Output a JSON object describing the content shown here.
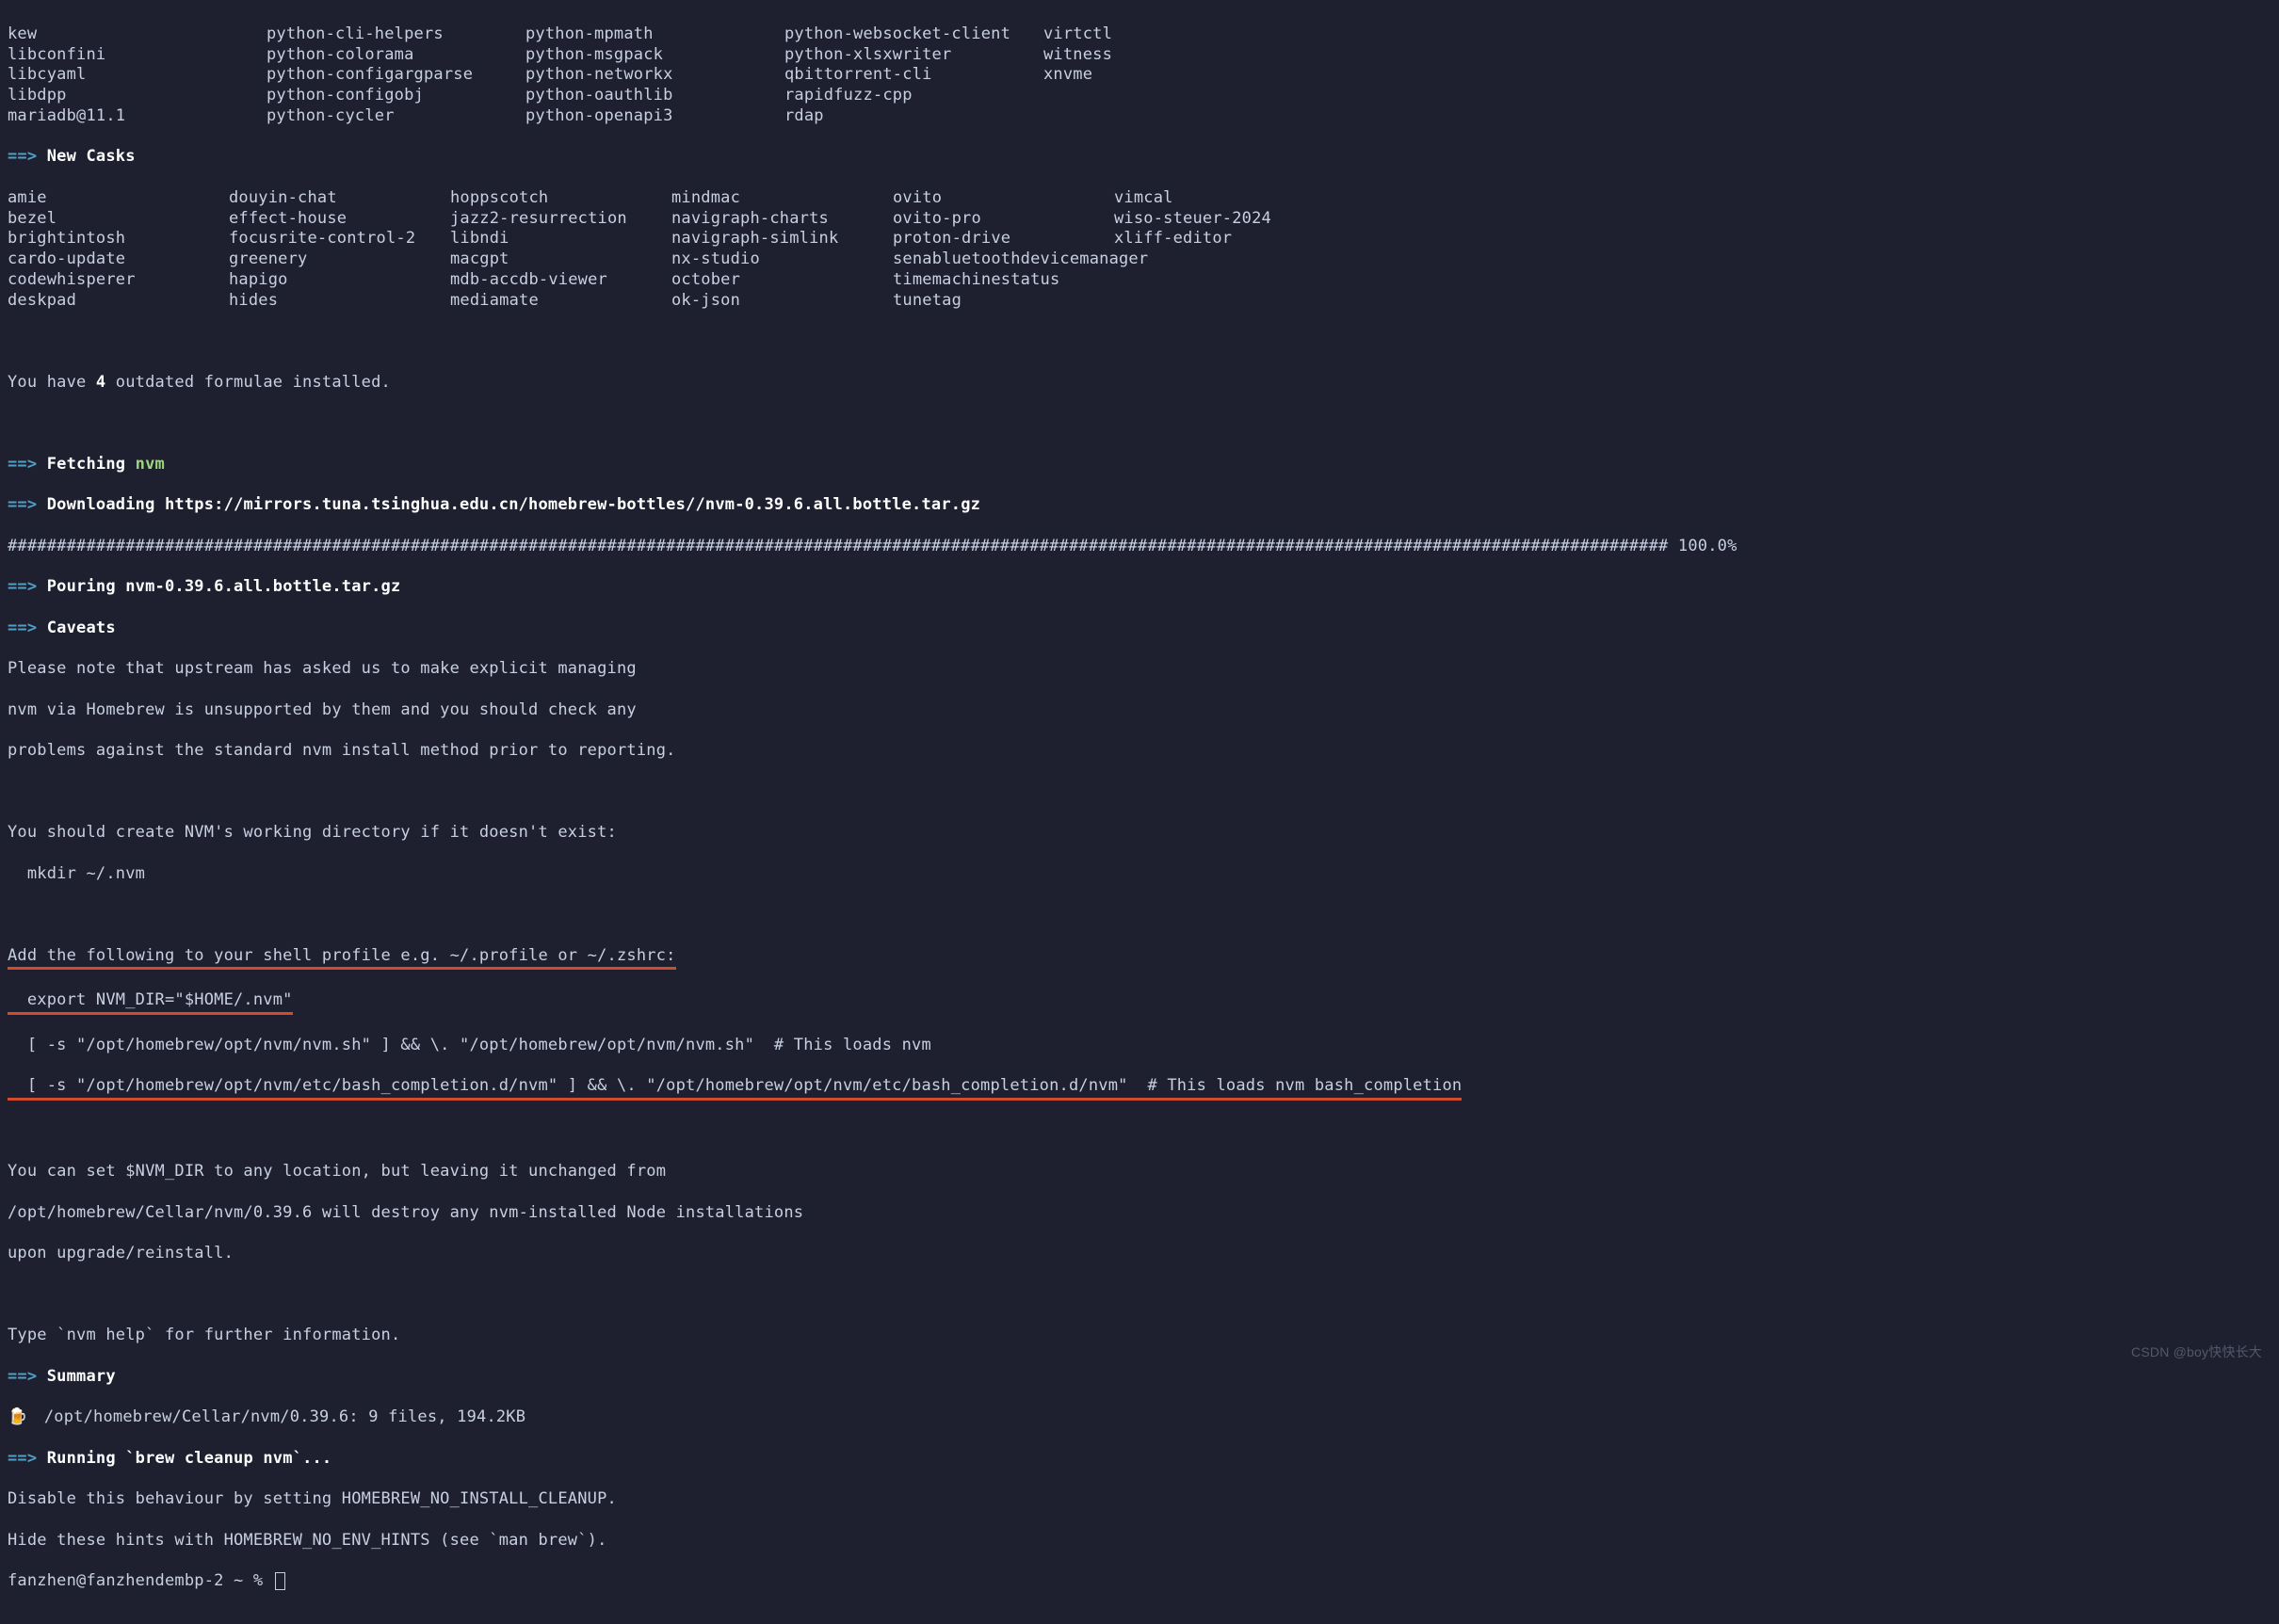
{
  "formulae_remaining": [
    [
      "kew",
      "python-cli-helpers",
      "python-mpmath",
      "python-websocket-client",
      "virtctl"
    ],
    [
      "libconfini",
      "python-colorama",
      "python-msgpack",
      "python-xlsxwriter",
      "witness"
    ],
    [
      "libcyaml",
      "python-configargparse",
      "python-networkx",
      "qbittorrent-cli",
      "xnvme"
    ],
    [
      "libdpp",
      "python-configobj",
      "python-oauthlib",
      "rapidfuzz-cpp",
      ""
    ],
    [
      "mariadb@11.1",
      "python-cycler",
      "python-openapi3",
      "rdap",
      ""
    ]
  ],
  "casks_heading": "New Casks",
  "casks": [
    [
      "amie",
      "douyin-chat",
      "hoppscotch",
      "mindmac",
      "ovito",
      "vimcal"
    ],
    [
      "bezel",
      "effect-house",
      "jazz2-resurrection",
      "navigraph-charts",
      "ovito-pro",
      "wiso-steuer-2024"
    ],
    [
      "brightintosh",
      "focusrite-control-2",
      "libndi",
      "navigraph-simlink",
      "proton-drive",
      "xliff-editor"
    ],
    [
      "cardo-update",
      "greenery",
      "macgpt",
      "nx-studio",
      "senabluetoothdevicemanager",
      ""
    ],
    [
      "codewhisperer",
      "hapigo",
      "mdb-accdb-viewer",
      "october",
      "timemachinestatus",
      ""
    ],
    [
      "deskpad",
      "hides",
      "mediamate",
      "ok-json",
      "tunetag",
      ""
    ]
  ],
  "outdated_line_a": "You have ",
  "outdated_count": "4",
  "outdated_line_b": " outdated formulae installed.",
  "fetching_label": "Fetching ",
  "fetching_pkg": "nvm",
  "downloading_label": "Downloading ",
  "download_url": "https://mirrors.tuna.tsinghua.edu.cn/homebrew-bottles//nvm-0.39.6.all.bottle.tar.gz",
  "progress_bar": "######################################################################################################################################################################### 100.0%",
  "pouring_label": "Pouring ",
  "pouring_file": "nvm-0.39.6.all.bottle.tar.gz",
  "caveats_label": "Caveats",
  "caveats_body_1": "Please note that upstream has asked us to make explicit managing",
  "caveats_body_2": "nvm via Homebrew is unsupported by them and you should check any",
  "caveats_body_3": "problems against the standard nvm install method prior to reporting.",
  "caveats_body_4": "You should create NVM's working directory if it doesn't exist:",
  "caveats_body_5": "  mkdir ~/.nvm",
  "caveats_body_6": "Add the following to your shell profile e.g. ~/.profile or ~/.zshrc:",
  "export_line": "  export NVM_DIR=\"$HOME/.nvm\"",
  "load_nvm_line": "  [ -s \"/opt/homebrew/opt/nvm/nvm.sh\" ] && \\. \"/opt/homebrew/opt/nvm/nvm.sh\"  # This loads nvm",
  "load_bash_line": "  [ -s \"/opt/homebrew/opt/nvm/etc/bash_completion.d/nvm\" ] && \\. \"/opt/homebrew/opt/nvm/etc/bash_completion.d/nvm\"  # This loads nvm bash_completion",
  "caveats_body_7": "You can set $NVM_DIR to any location, but leaving it unchanged from",
  "caveats_body_8": "/opt/homebrew/Cellar/nvm/0.39.6 will destroy any nvm-installed Node installations",
  "caveats_body_9": "upon upgrade/reinstall.",
  "caveats_body_10": "Type `nvm help` for further information.",
  "summary_label": "Summary",
  "beer_icon": "🍺",
  "summary_line": "  /opt/homebrew/Cellar/nvm/0.39.6: 9 files, 194.2KB",
  "running_label": "Running ",
  "running_cmd": "`brew cleanup nvm`",
  "running_suffix": "...",
  "cleanup_1": "Disable this behaviour by setting HOMEBREW_NO_INSTALL_CLEANUP.",
  "cleanup_2": "Hide these hints with HOMEBREW_NO_ENV_HINTS (see `man brew`).",
  "prompt": "fanzhen@fanzhendembp-2 ~ % ",
  "watermark": "CSDN @boy快快长大"
}
